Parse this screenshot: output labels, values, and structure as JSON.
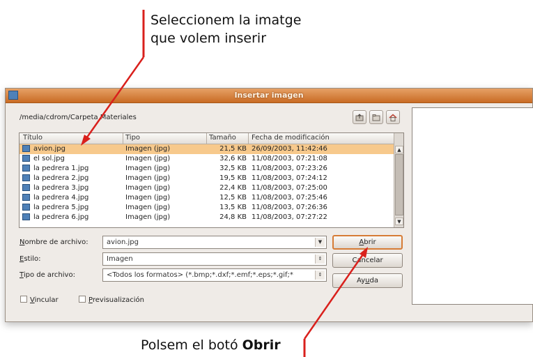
{
  "annotation_top": {
    "line1": "Seleccionem la imatge",
    "line2": "que volem inserir"
  },
  "annotation_bottom": {
    "prefix": "Polsem el botó ",
    "bold": "Obrir"
  },
  "dialog": {
    "title": "Insertar imagen",
    "path": "/media/cdrom/Carpeta Materiales",
    "toolbar_icons": [
      "up-folder-icon",
      "new-folder-icon",
      "home-icon"
    ],
    "columns": [
      "Título",
      "Tipo",
      "Tamaño",
      "Fecha de modificación"
    ],
    "files": [
      {
        "name": "avion.jpg",
        "type": "Imagen (jpg)",
        "size": "21,5 KB",
        "date": "26/09/2003, 11:42:46",
        "selected": true
      },
      {
        "name": "el sol.jpg",
        "type": "Imagen (jpg)",
        "size": "32,6 KB",
        "date": "11/08/2003, 07:21:08"
      },
      {
        "name": "la pedrera 1.jpg",
        "type": "Imagen (jpg)",
        "size": "32,5 KB",
        "date": "11/08/2003, 07:23:26"
      },
      {
        "name": "la pedrera 2.jpg",
        "type": "Imagen (jpg)",
        "size": "19,5 KB",
        "date": "11/08/2003, 07:24:12"
      },
      {
        "name": "la pedrera 3.jpg",
        "type": "Imagen (jpg)",
        "size": "22,4 KB",
        "date": "11/08/2003, 07:25:00"
      },
      {
        "name": "la pedrera 4.jpg",
        "type": "Imagen (jpg)",
        "size": "12,5 KB",
        "date": "11/08/2003, 07:25:46"
      },
      {
        "name": "la pedrera 5.jpg",
        "type": "Imagen (jpg)",
        "size": "13,5 KB",
        "date": "11/08/2003, 07:26:36"
      },
      {
        "name": "la pedrera 6.jpg",
        "type": "Imagen (jpg)",
        "size": "24,8 KB",
        "date": "11/08/2003, 07:27:22"
      }
    ],
    "filename_label": {
      "mnemonic": "N",
      "rest": "ombre de archivo:"
    },
    "filename_value": "avion.jpg",
    "style_label": {
      "mnemonic": "E",
      "rest": "stilo:"
    },
    "style_value": "Imagen",
    "filetype_label": {
      "mnemonic": "T",
      "rest": "ipo de archivo:"
    },
    "filetype_value": "<Todos los formatos> (*.bmp;*.dxf;*.emf;*.eps;*.gif;*",
    "open_button": {
      "mnemonic": "A",
      "rest": "brir"
    },
    "cancel_button": "Cancelar",
    "help_button": {
      "pre": "Ay",
      "mnemonic": "u",
      "post": "da"
    },
    "link_checkbox": {
      "mnemonic": "V",
      "rest": "incular",
      "checked": false
    },
    "preview_checkbox": {
      "mnemonic": "P",
      "rest": "revisualización",
      "checked": false
    }
  },
  "colors": {
    "titlebar": "#d9823f",
    "selection": "#f7c98c",
    "arrow": "#d9201c"
  }
}
